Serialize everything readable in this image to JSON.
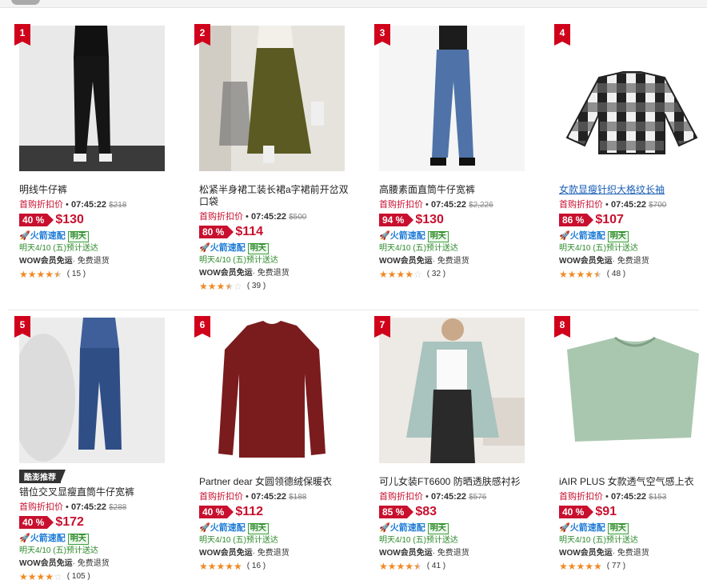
{
  "products": [
    {
      "rank": "1",
      "title": "明线牛仔裤",
      "promo_label": "首购折扣价",
      "time": "07:45:22",
      "orig_price": "$218",
      "discount": "40 %",
      "price": "$130",
      "rocket": "火箭速配",
      "tomorrow": "明天",
      "deliver": "明天4/10 (五)预计送达",
      "wow": "WOW会员免运",
      "wow_extra": "· 免费退货",
      "stars": 4.5,
      "reviews": "( 15 )",
      "link": false,
      "badge": ""
    },
    {
      "rank": "2",
      "title": "松紧半身裙工装长裙a字裙前开岔双口袋",
      "promo_label": "首购折扣价",
      "time": "07:45:22",
      "orig_price": "$500",
      "discount": "80 %",
      "price": "$114",
      "rocket": "火箭速配",
      "tomorrow": "明天",
      "deliver": "明天4/10 (五)预计送达",
      "wow": "WOW会员免运",
      "wow_extra": "· 免费退货",
      "stars": 3.5,
      "reviews": "( 39 )",
      "link": false,
      "badge": ""
    },
    {
      "rank": "3",
      "title": "高腰素面直筒牛仔宽裤",
      "promo_label": "首购折扣价",
      "time": "07:45:22",
      "orig_price": "$2,226",
      "discount": "94 %",
      "price": "$130",
      "rocket": "火箭速配",
      "tomorrow": "明天",
      "deliver": "明天4/10 (五)预计送达",
      "wow": "WOW会员免运",
      "wow_extra": "· 免费退货",
      "stars": 4,
      "reviews": "( 32 )",
      "link": false,
      "badge": ""
    },
    {
      "rank": "4",
      "title": "女款显瘦针织大格纹长袖",
      "promo_label": "首购折扣价",
      "time": "07:45:22",
      "orig_price": "$700",
      "discount": "86 %",
      "price": "$107",
      "rocket": "火箭速配",
      "tomorrow": "明天",
      "deliver": "明天4/10 (五)预计送达",
      "wow": "WOW会员免运",
      "wow_extra": "· 免费退货",
      "stars": 4.5,
      "reviews": "( 48 )",
      "link": true,
      "badge": ""
    },
    {
      "rank": "5",
      "title": "错位交叉显瘦直筒牛仔宽裤",
      "promo_label": "首购折扣价",
      "time": "07:45:22",
      "orig_price": "$288",
      "discount": "40 %",
      "price": "$172",
      "rocket": "火箭速配",
      "tomorrow": "明天",
      "deliver": "明天4/10 (五)预计送达",
      "wow": "WOW会员免运",
      "wow_extra": "· 免费退货",
      "stars": 4,
      "reviews": "( 105 )",
      "link": false,
      "badge": "酷澎推荐"
    },
    {
      "rank": "6",
      "title": "Partner dear 女圆领德绒保暖衣",
      "promo_label": "首购折扣价",
      "time": "07:45:22",
      "orig_price": "$188",
      "discount": "40 %",
      "price": "$112",
      "rocket": "火箭速配",
      "tomorrow": "明天",
      "deliver": "明天4/10 (五)预计送达",
      "wow": "WOW会员免运",
      "wow_extra": "· 免费退货",
      "stars": 5,
      "reviews": "( 16 )",
      "link": false,
      "badge": ""
    },
    {
      "rank": "7",
      "title": "可儿女装FT6600 防晒透肤感衬衫",
      "promo_label": "首购折扣价",
      "time": "07:45:22",
      "orig_price": "$576",
      "discount": "85 %",
      "price": "$83",
      "rocket": "火箭速配",
      "tomorrow": "明天",
      "deliver": "明天4/10 (五)预计送达",
      "wow": "WOW会员免运",
      "wow_extra": "· 免费退货",
      "stars": 4.5,
      "reviews": "( 41 )",
      "link": false,
      "badge": ""
    },
    {
      "rank": "8",
      "title": "iAIR PLUS 女款透气空气感上衣",
      "promo_label": "首购折扣价",
      "time": "07:45:22",
      "orig_price": "$153",
      "discount": "40 %",
      "price": "$91",
      "rocket": "火箭速配",
      "tomorrow": "明天",
      "deliver": "明天4/10 (五)预计送达",
      "wow": "WOW会员免运",
      "wow_extra": "· 免费退货",
      "stars": 5,
      "reviews": "( 77 )",
      "link": false,
      "badge": ""
    }
  ],
  "colors": {
    "accent_red": "#c8102e",
    "rocket_blue": "#1e7bd6",
    "green": "#2d8a2a",
    "star_orange": "#f08a24"
  }
}
